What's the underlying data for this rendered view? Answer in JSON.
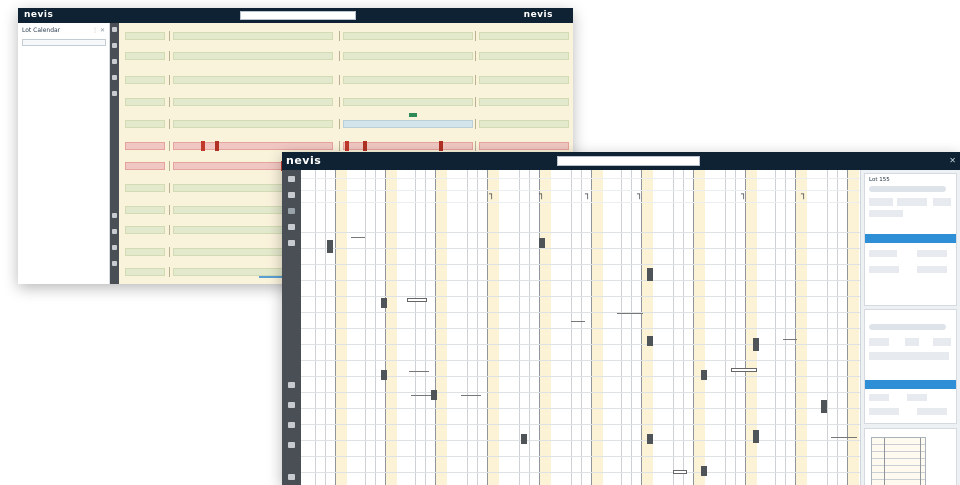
{
  "back_window": {
    "brand": "nevis",
    "brand_right": "nevis",
    "panel": {
      "title": "Lot Calendar",
      "title_icons": "⋮ ✕",
      "fields": [
        "",
        "",
        "",
        "",
        "",
        ""
      ],
      "list_items": [
        "",
        "",
        "",
        "",
        "",
        "",
        "",
        "",
        "",
        ""
      ]
    }
  },
  "front_window": {
    "brand": "nevis",
    "close_glyph": "✕",
    "column_labels": [
      "",
      "",
      "",
      "",
      "",
      "",
      "",
      "",
      "",
      "",
      ""
    ],
    "right_panel": {
      "card1_title": "Lot 155",
      "card1_bar": "",
      "card2_title": "",
      "card2_bar": ""
    }
  },
  "colors": {
    "titlebar": "#0f2233",
    "gantt_background": "#faf3dc",
    "segment_green": "#e3e9cc",
    "segment_pink": "#f0c7c2",
    "marker_red": "#c0392b",
    "accent_blue": "#2f8fd6",
    "toolbar_gray": "#4a4f55"
  },
  "icons": [
    "home-icon",
    "filter-icon",
    "calendar-icon",
    "edit-icon",
    "zoom-in-icon",
    "zoom-out-icon",
    "settings-icon",
    "close-icon"
  ]
}
